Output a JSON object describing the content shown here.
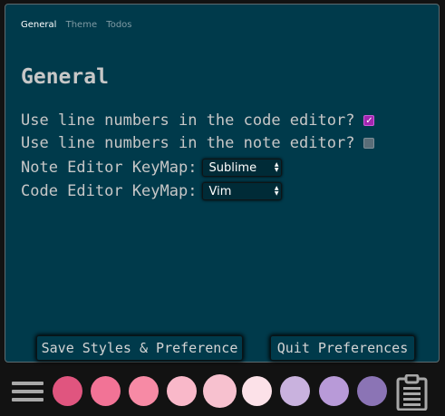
{
  "tabs": [
    {
      "label": "General"
    },
    {
      "label": "Theme"
    },
    {
      "label": "Todos"
    }
  ],
  "title": "General",
  "settings": {
    "code_line_numbers": {
      "label": "Use line numbers in the code editor?",
      "checked": true
    },
    "note_line_numbers": {
      "label": "Use line numbers in the note editor?",
      "checked": false
    },
    "note_keymap": {
      "label": "Note Editor KeyMap:",
      "value": "Sublime"
    },
    "code_keymap": {
      "label": "Code Editor KeyMap:",
      "value": "Vim"
    }
  },
  "buttons": {
    "save": "Save Styles & Preference",
    "quit": "Quit Preferences"
  },
  "colors": {
    "panel": "#003a4b",
    "checkbox_on": "#a327b0",
    "swatches": [
      "#e0557f",
      "#f27396",
      "#f78aa5",
      "#f9b8c9",
      "#f7c1cf",
      "#fce1e8",
      "#c9b2de",
      "#b89ad8",
      "#8b74b5"
    ]
  },
  "icons": {
    "menu": "hamburger-menu-icon",
    "clipboard": "clipboard-icon"
  }
}
